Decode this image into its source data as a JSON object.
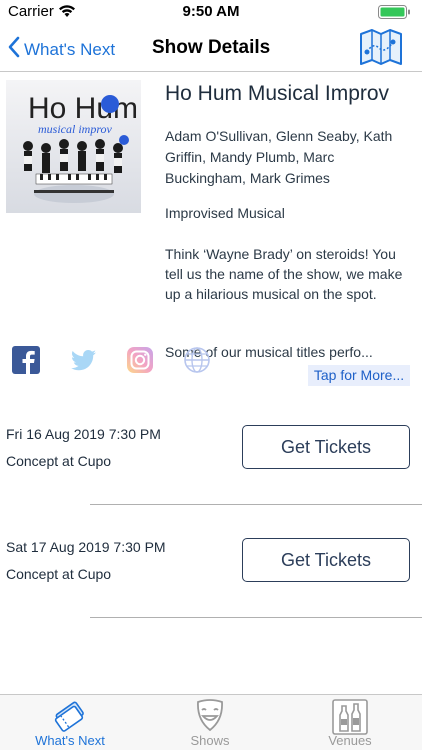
{
  "status_bar": {
    "carrier": "Carrier",
    "time": "9:50 AM"
  },
  "nav": {
    "back_label": "What's Next",
    "title": "Show Details"
  },
  "show": {
    "poster_text": "Ho Hum",
    "poster_subtext": "musical improv",
    "title": "Ho Hum Musical Improv",
    "cast": "Adam O'Sullivan, Glenn Seaby, Kath Griffin, Mandy Plumb, Marc Buckingham, Mark Grimes",
    "genre": "Improvised Musical",
    "description": "Think ‘Wayne Brady’ on steroids! You tell us the name of the show, we make up a hilarious musical on the spot.",
    "description_more": "Some of our musical titles perfo...",
    "tap_more": "Tap for More..."
  },
  "social": [
    "facebook-icon",
    "twitter-icon",
    "instagram-icon",
    "globe-icon"
  ],
  "performances": [
    {
      "date": "Fri 16 Aug 2019 7:30 PM",
      "venue": "Concept at Cupo",
      "button": "Get Tickets"
    },
    {
      "date": "Sat 17 Aug 2019 7:30 PM",
      "venue": "Concept at Cupo",
      "button": "Get Tickets"
    }
  ],
  "tabs": [
    {
      "label": "What's Next",
      "icon": "tickets-icon",
      "active": true
    },
    {
      "label": "Shows",
      "icon": "theater-mask-icon",
      "active": false
    },
    {
      "label": "Venues",
      "icon": "bottles-icon",
      "active": false
    }
  ],
  "colors": {
    "accent": "#1e73d8",
    "button_border": "#2c3e5a",
    "tap_more_bg": "#e8eefc"
  }
}
